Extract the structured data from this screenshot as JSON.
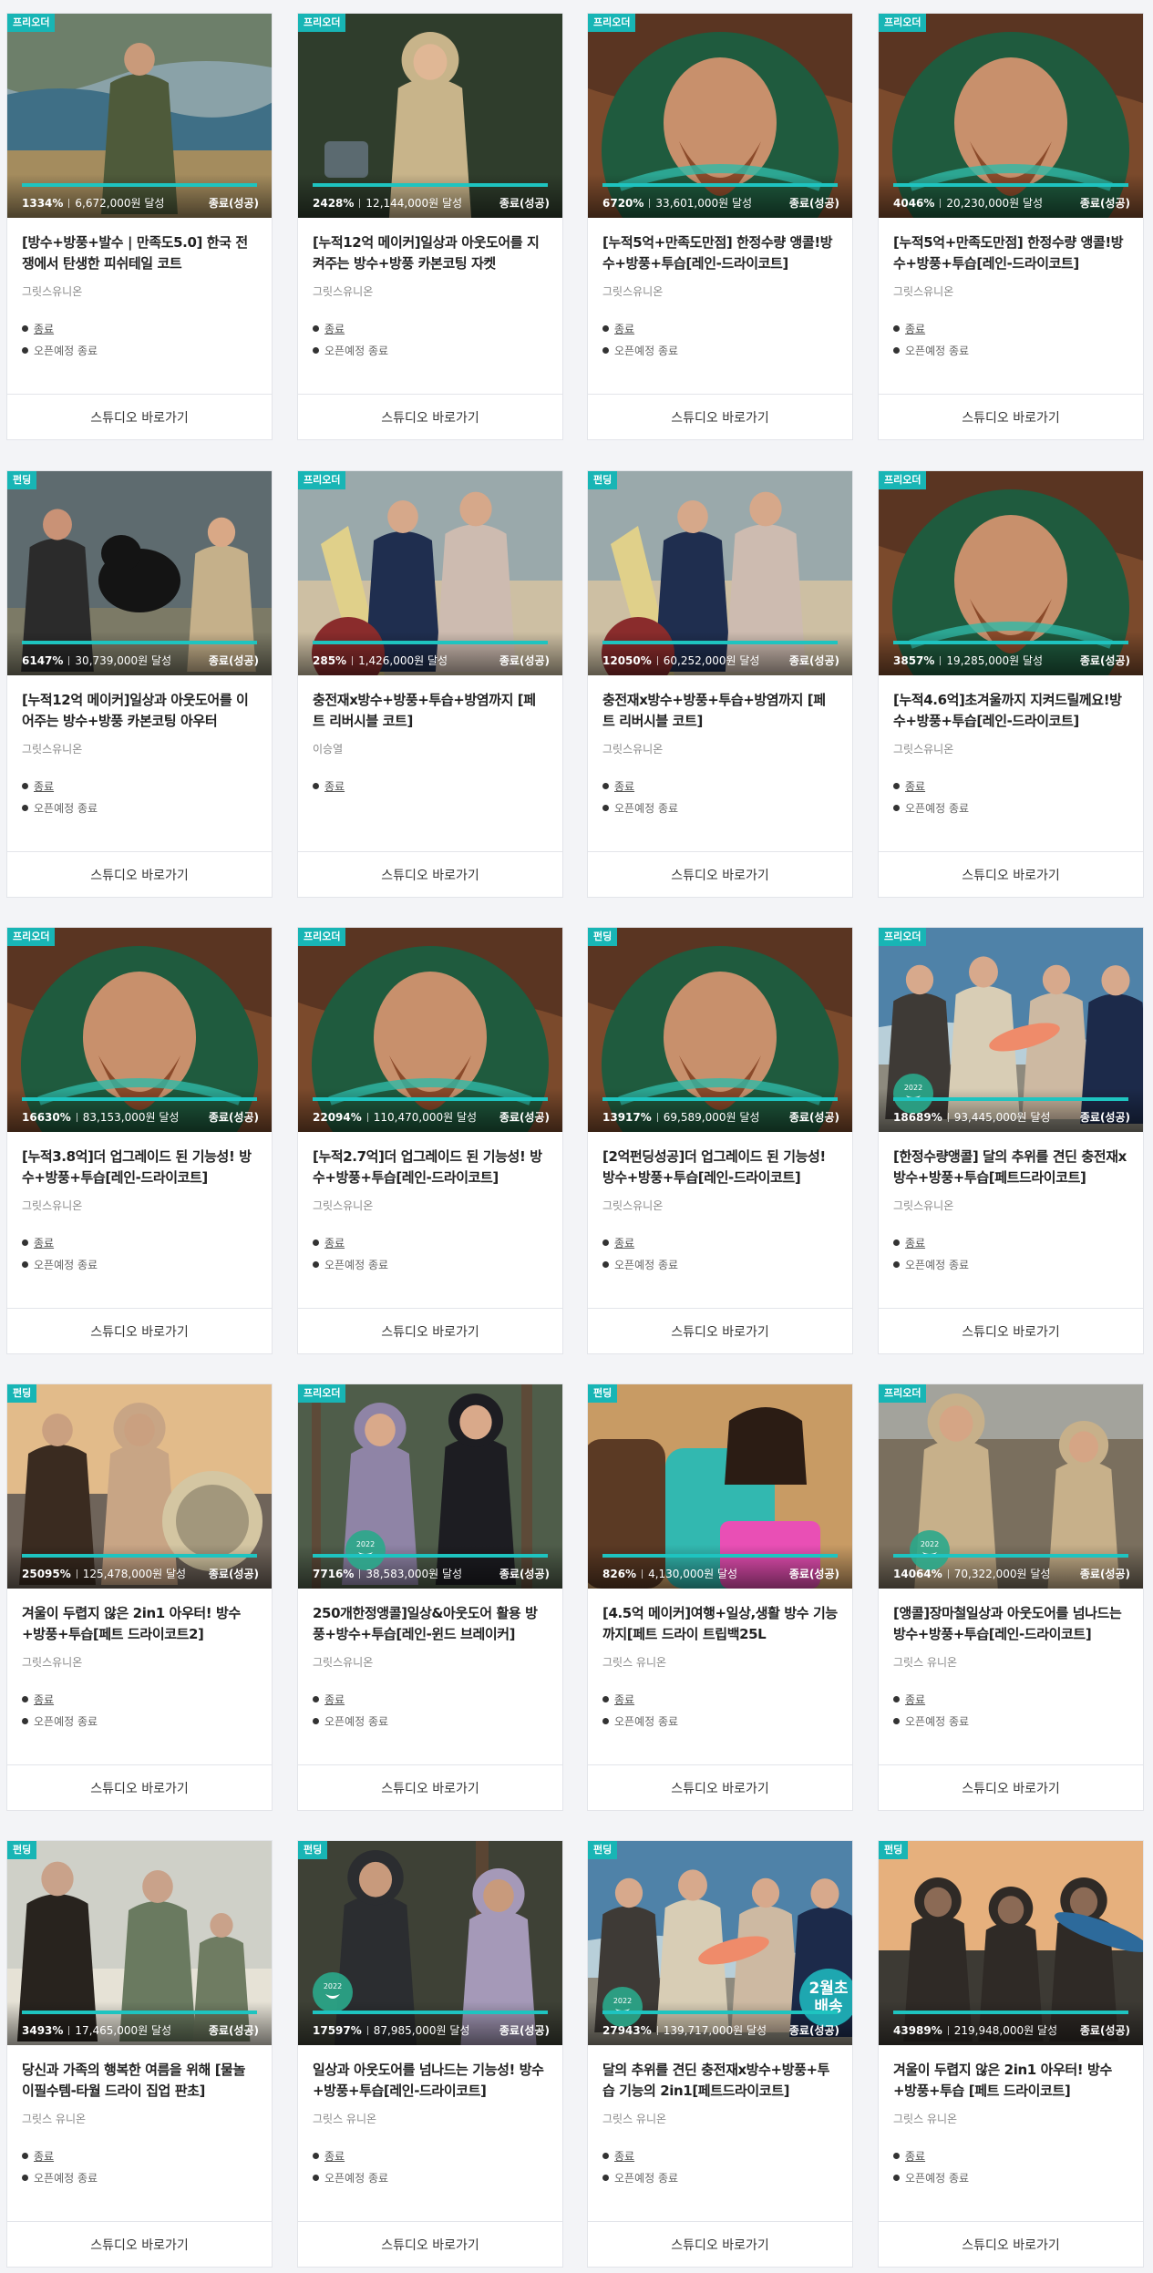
{
  "page": {
    "studio_button_label": "스튜디오 바로가기",
    "meta_end_label": "종료",
    "meta_open_label": "오픈예정 종료",
    "accent_color": "#1ec4c0",
    "badge_color": "#18b5b5"
  },
  "cards": [
    {
      "badge": "프리오더",
      "pct": "1334%",
      "amount": "6,672,000원 달성",
      "status": "종료(성공)",
      "title": "[방수+방풍+발수 | 만족도5.0] 한국 전쟁에서 탄생한 피쉬테일 코트",
      "maker": "그릿스유니온",
      "show_open": true,
      "scene": "lake"
    },
    {
      "badge": "프리오더",
      "pct": "2428%",
      "amount": "12,144,000원 달성",
      "status": "종료(성공)",
      "title": "[누적12억 메이커]일상과 아웃도어를 지켜주는 방수+방풍 카본코팅 자켓",
      "maker": "그릿스유니온",
      "show_open": true,
      "scene": "rain-tan"
    },
    {
      "badge": "프리오더",
      "pct": "6720%",
      "amount": "33,601,000원 달성",
      "status": "종료(성공)",
      "title": "[누적5억+만족도만점] 한정수량 앵콜!방수+방풍+투습[레인-드라이코트]",
      "maker": "그릿스유니온",
      "show_open": true,
      "scene": "green-hood"
    },
    {
      "badge": "프리오더",
      "pct": "4046%",
      "amount": "20,230,000원 달성",
      "status": "종료(성공)",
      "title": "[누적5억+만족도만점] 한정수량 앵콜!방수+방풍+투습[레인-드라이코트]",
      "maker": "그릿스유니온",
      "show_open": true,
      "scene": "green-hood"
    },
    {
      "badge": "펀딩",
      "pct": "6147%",
      "amount": "30,739,000원 달성",
      "status": "종료(성공)",
      "title": "[누적12억 메이커]일상과 아웃도어를 이어주는 방수+방풍 카본코팅 아우터",
      "maker": "그릿스유니온",
      "show_open": true,
      "scene": "dog"
    },
    {
      "badge": "프리오더",
      "pct": "285%",
      "amount": "1,426,000원 달성",
      "status": "종료(성공)",
      "title": "충전재x방수+방풍+투습+방염까지 [페트 리버시블 코트]",
      "maker": "이승열",
      "show_open": false,
      "scene": "beach-couple"
    },
    {
      "badge": "펀딩",
      "pct": "12050%",
      "amount": "60,252,000원 달성",
      "status": "종료(성공)",
      "title": "충전재x방수+방풍+투습+방염까지 [페트 리버시블 코트]",
      "maker": "그릿스유니온",
      "show_open": true,
      "scene": "beach-couple"
    },
    {
      "badge": "프리오더",
      "pct": "3857%",
      "amount": "19,285,000원 달성",
      "status": "종료(성공)",
      "title": "[누적4.6억]초겨울까지 지켜드릴께요!방수+방풍+투습[레인-드라이코트]",
      "maker": "그릿스유니온",
      "show_open": true,
      "scene": "green-hood"
    },
    {
      "badge": "프리오더",
      "pct": "16630%",
      "amount": "83,153,000원 달성",
      "status": "종료(성공)",
      "title": "[누적3.8억]더 업그레이드 된 기능성! 방수+방풍+투습[레인-드라이코트]",
      "maker": "그릿스유니온",
      "show_open": true,
      "scene": "green-hood"
    },
    {
      "badge": "프리오더",
      "pct": "22094%",
      "amount": "110,470,000원 달성",
      "status": "종료(성공)",
      "title": "[누적2.7억]더 업그레이드 된 기능성! 방수+방풍+투습[레인-드라이코트]",
      "maker": "그릿스유니온",
      "show_open": true,
      "scene": "green-hood"
    },
    {
      "badge": "펀딩",
      "pct": "13917%",
      "amount": "69,589,000원 달성",
      "status": "종료(성공)",
      "title": "[2억펀딩성공]더 업그레이드 된 기능성!방수+방풍+투습[레인-드라이코트]",
      "maker": "그릿스유니온",
      "show_open": true,
      "scene": "green-hood"
    },
    {
      "badge": "프리오더",
      "pct": "18689%",
      "amount": "93,445,000원 달성",
      "status": "종료(성공)",
      "title": "[한정수량앵콜] 달의 추위를 견딘 충전재x방수+방풍+투습[페트드라이코트]",
      "maker": "그릿스유니온",
      "show_open": true,
      "scene": "surf"
    },
    {
      "badge": "펀딩",
      "pct": "25095%",
      "amount": "125,478,000원 달성",
      "status": "종료(성공)",
      "title": "겨울이 두렵지 않은 2in1 아우터! 방수+방풍+투습[페트 드라이코트2]",
      "maker": "그릿스유니온",
      "show_open": true,
      "scene": "sunset-fleece"
    },
    {
      "badge": "프리오더",
      "pct": "7716%",
      "amount": "38,583,000원 달성",
      "status": "종료(성공)",
      "title": "250개한정앵콜]일상&아웃도어 활용 방풍+방수+투습[레인-윈드 브레이커]",
      "maker": "그릿스유니온",
      "show_open": true,
      "scene": "forest-purple"
    },
    {
      "badge": "펀딩",
      "pct": "826%",
      "amount": "4,130,000원 달성",
      "status": "종료(성공)",
      "title": "[4.5억 메이커]여행+일상,생활 방수 기능까지[페트 드라이 트립백25L",
      "maker": "그릿스 유니온",
      "show_open": true,
      "scene": "bags"
    },
    {
      "badge": "프리오더",
      "pct": "14064%",
      "amount": "70,322,000원 달성",
      "status": "종료(성공)",
      "title": "[앵콜]장마철일상과 아웃도어를 넘나드는 방수+방풍+투습[레인-드라이코트]",
      "maker": "그릿스 유니온",
      "show_open": true,
      "scene": "tan-duo"
    },
    {
      "badge": "펀딩",
      "pct": "3493%",
      "amount": "17,465,000원 달성",
      "status": "종료(성공)",
      "title": "당신과 가족의 행복한 여름을 위해 [물놀이필수템-타월 드라이 집업 판초]",
      "maker": "그릿스 유니온",
      "show_open": true,
      "scene": "family"
    },
    {
      "badge": "펀딩",
      "pct": "17597%",
      "amount": "87,985,000원 달성",
      "status": "종료(성공)",
      "title": "일상과 아웃도어를 넘나드는 기능성! 방수+방풍+투습[레인-드라이코트]",
      "maker": "그릿스 유니온",
      "show_open": true,
      "scene": "forest-rain"
    },
    {
      "badge": "펀딩",
      "pct": "27943%",
      "amount": "139,717,000원 달성",
      "status": "종료(성공)",
      "title": "달의 추위를 견딘 충전재x방수+방풍+투습 기능의 2in1[페트드라이코트]",
      "maker": "그릿스 유니온",
      "show_open": true,
      "scene": "surf",
      "promo": "2월초\n배송"
    },
    {
      "badge": "펀딩",
      "pct": "43989%",
      "amount": "219,948,000원 달성",
      "status": "종료(성공)",
      "title": "겨울이 두렵지 않은 2in1 아우터! 방수+방풍+투습 [페트 드라이코트]",
      "maker": "그릿스 유니온",
      "show_open": true,
      "scene": "sunset-surf"
    }
  ]
}
